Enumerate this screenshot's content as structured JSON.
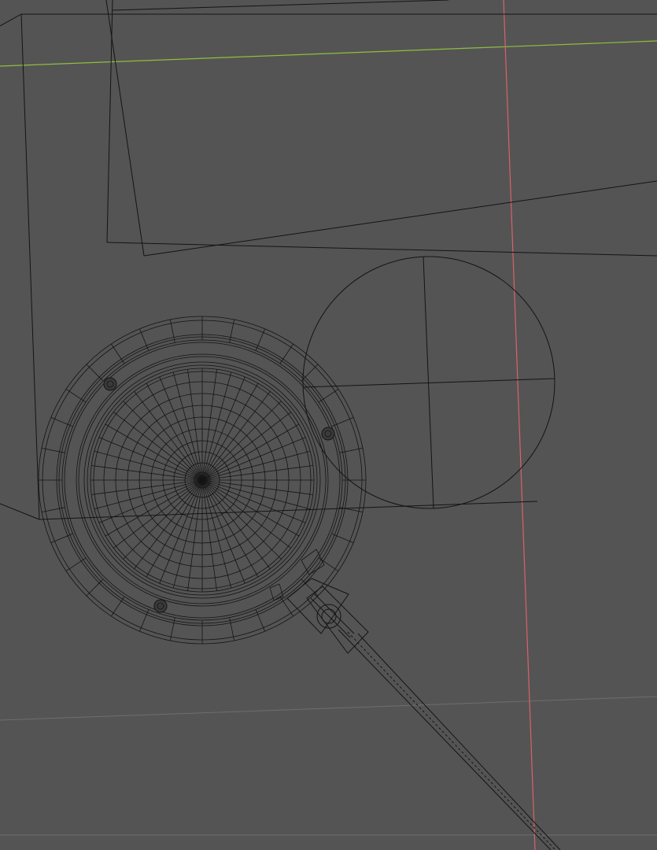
{
  "viewport": {
    "mode": "wireframe",
    "background_color": "#545454"
  },
  "colors": {
    "wire": "#141414",
    "axis_x": "#d9626b",
    "axis_y": "#8fbf3c",
    "grid": "#6e6e6e"
  },
  "objects": [
    {
      "name": "floor-plane-1"
    },
    {
      "name": "floor-plane-2"
    },
    {
      "name": "sphere-object"
    },
    {
      "name": "pan-body"
    },
    {
      "name": "pan-handle"
    }
  ]
}
